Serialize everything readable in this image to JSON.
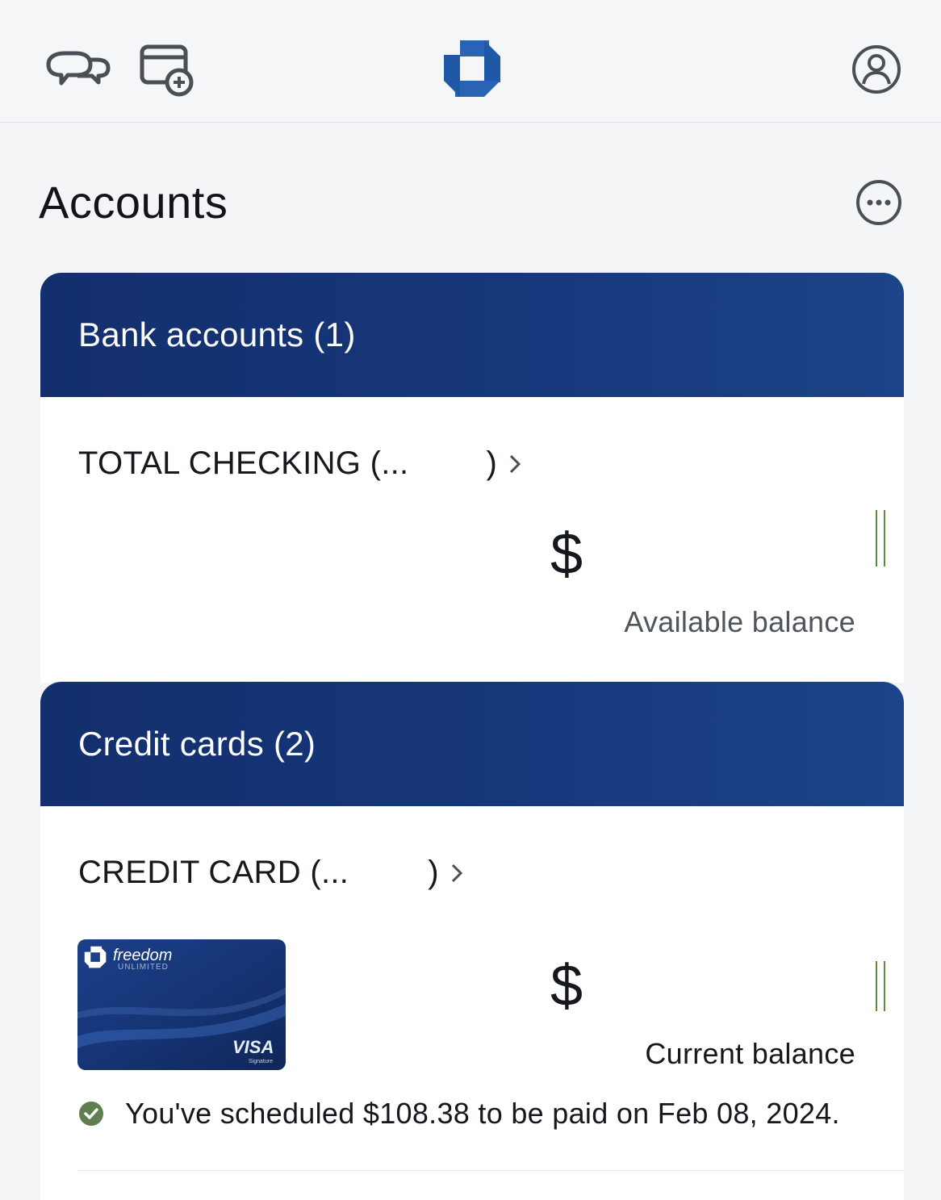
{
  "topbar": {
    "icons": [
      "chat-icon",
      "card-add-icon",
      "chase-logo",
      "profile-icon"
    ],
    "brand_color": "#2058a8"
  },
  "page": {
    "title": "Accounts",
    "more_icon": "more-icon"
  },
  "bank_accounts": {
    "header": "Bank accounts (1)",
    "accounts": [
      {
        "name": "TOTAL CHECKING (...",
        "name_close": ")",
        "amount": "$",
        "balance_label": "Available balance"
      }
    ]
  },
  "credit_cards": {
    "header": "Credit cards (2)",
    "cards": [
      {
        "name": "CREDIT CARD (...",
        "name_close": ")",
        "card_brand": "freedom",
        "card_sub": "UNLIMITED",
        "card_network": "VISA",
        "card_network_sub": "Signature",
        "amount": "$",
        "balance_label": "Current balance",
        "scheduled_message": "You've scheduled $108.38 to be paid on Feb 08, 2024."
      }
    ]
  },
  "colors": {
    "header_bg": "#17387c",
    "success_green": "#5f7f52"
  }
}
